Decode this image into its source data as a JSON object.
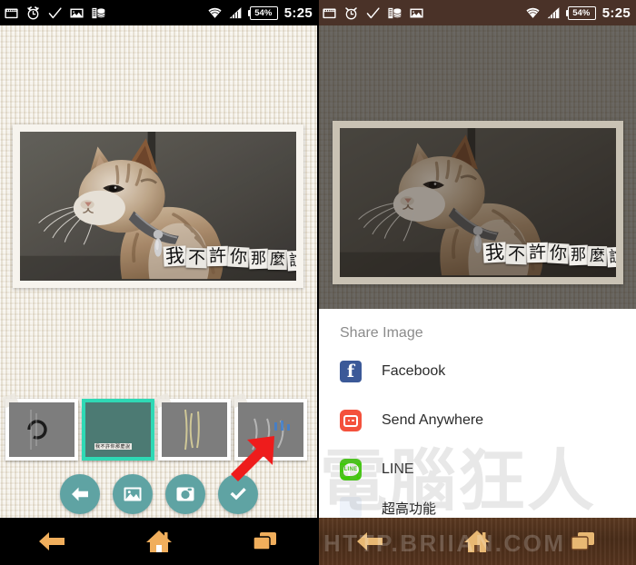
{
  "left_panel": {
    "status_bar": {
      "icons": [
        "calendar-icon",
        "alarm-clock-icon",
        "check-icon",
        "image-icon",
        "database-stack-icon"
      ],
      "wifi": "wifi-icon",
      "signal": "signal-bars-icon",
      "battery_percent": "54%",
      "time": "5:25",
      "background": "#000000"
    },
    "photo": {
      "caption_chars": [
        "我",
        "不",
        "許",
        "你",
        "那",
        "麼",
        "說"
      ],
      "caption_text": "我不許你那麼說",
      "alt": "tabby cat with collar looking down, gray studio background"
    },
    "thumbnails": [
      {
        "name": "thumb-1-loading",
        "selected": false
      },
      {
        "name": "thumb-2-caption",
        "selected": true
      },
      {
        "name": "thumb-3-strokes",
        "selected": false
      },
      {
        "name": "thumb-4-smoke",
        "selected": false
      }
    ],
    "toolbar": [
      {
        "name": "back-button",
        "icon": "arrow-left-icon"
      },
      {
        "name": "gallery-button",
        "icon": "image-icon"
      },
      {
        "name": "camera-button",
        "icon": "camera-icon"
      },
      {
        "name": "confirm-button",
        "icon": "check-icon"
      }
    ],
    "toolbar_color": "#5fa3a3",
    "selected_thumb_border": "#2fd9b5",
    "nav_bar": {
      "background": "#000000",
      "items": [
        {
          "name": "nav-back",
          "icon": "arrow-left-icon"
        },
        {
          "name": "nav-home",
          "icon": "home-icon"
        },
        {
          "name": "nav-recents",
          "icon": "recents-icon"
        }
      ]
    },
    "annotation": {
      "name": "red-arrow",
      "points_to": "confirm-button",
      "color": "#ee1c1c"
    }
  },
  "right_panel": {
    "status_bar": {
      "icons": [
        "calendar-icon",
        "alarm-clock-icon",
        "check-icon",
        "database-stack-icon",
        "image-icon"
      ],
      "wifi": "wifi-icon",
      "signal": "signal-bars-icon",
      "battery_percent": "54%",
      "time": "5:25",
      "background": "#4a3228"
    },
    "photo": {
      "caption_text": "我不許你那麼說",
      "caption_chars": [
        "我",
        "不",
        "許",
        "你",
        "那",
        "麼",
        "說"
      ],
      "dimmed": true
    },
    "share_sheet": {
      "title": "Share Image",
      "items": [
        {
          "label": "Facebook",
          "icon": "facebook-icon",
          "color": "#3b5998"
        },
        {
          "label": "Send Anywhere",
          "icon": "send-anywhere-icon",
          "color": "#f4513c"
        },
        {
          "label": "LINE",
          "icon": "line-icon",
          "color": "#3ace01"
        },
        {
          "label": "超高功能",
          "icon": "app-icon",
          "color": "#eef3fa",
          "partial": true
        }
      ]
    },
    "nav_bar": {
      "background": "wood-texture",
      "items": [
        {
          "name": "nav-back",
          "icon": "arrow-left-icon"
        },
        {
          "name": "nav-home",
          "icon": "home-icon"
        },
        {
          "name": "nav-recents",
          "icon": "recents-icon"
        }
      ]
    },
    "watermark": {
      "chinese": "電腦狂人",
      "url": "HTTP.BRIIAN.COM"
    }
  }
}
